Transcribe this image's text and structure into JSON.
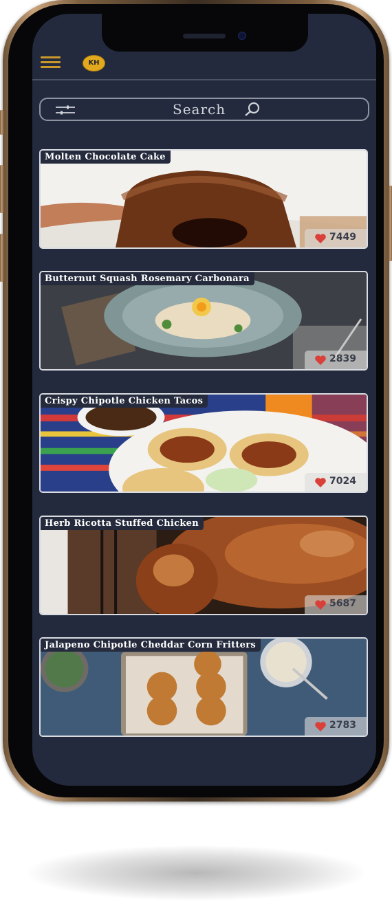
{
  "header": {
    "menu_icon": "hamburger-menu-icon",
    "avatar_initials": "KH",
    "accent_color": "#c99a2b",
    "avatar_color": "#e3a91e",
    "background_color": "#232a3d"
  },
  "search": {
    "label": "Search",
    "filter_icon": "filter-sliders-icon",
    "search_icon": "magnifier-icon"
  },
  "recipes": [
    {
      "title": "Molten Chocolate Cake",
      "likes": "7449"
    },
    {
      "title": "Butternut Squash Rosemary Carbonara",
      "likes": "2839"
    },
    {
      "title": "Crispy Chipotle Chicken Tacos",
      "likes": "7024"
    },
    {
      "title": "Herb Ricotta Stuffed Chicken",
      "likes": "5687"
    },
    {
      "title": "Jalapeno Chipotle Cheddar Corn Fritters",
      "likes": "2783"
    }
  ],
  "like_icon": "heart-icon",
  "like_color": "#d9403a"
}
